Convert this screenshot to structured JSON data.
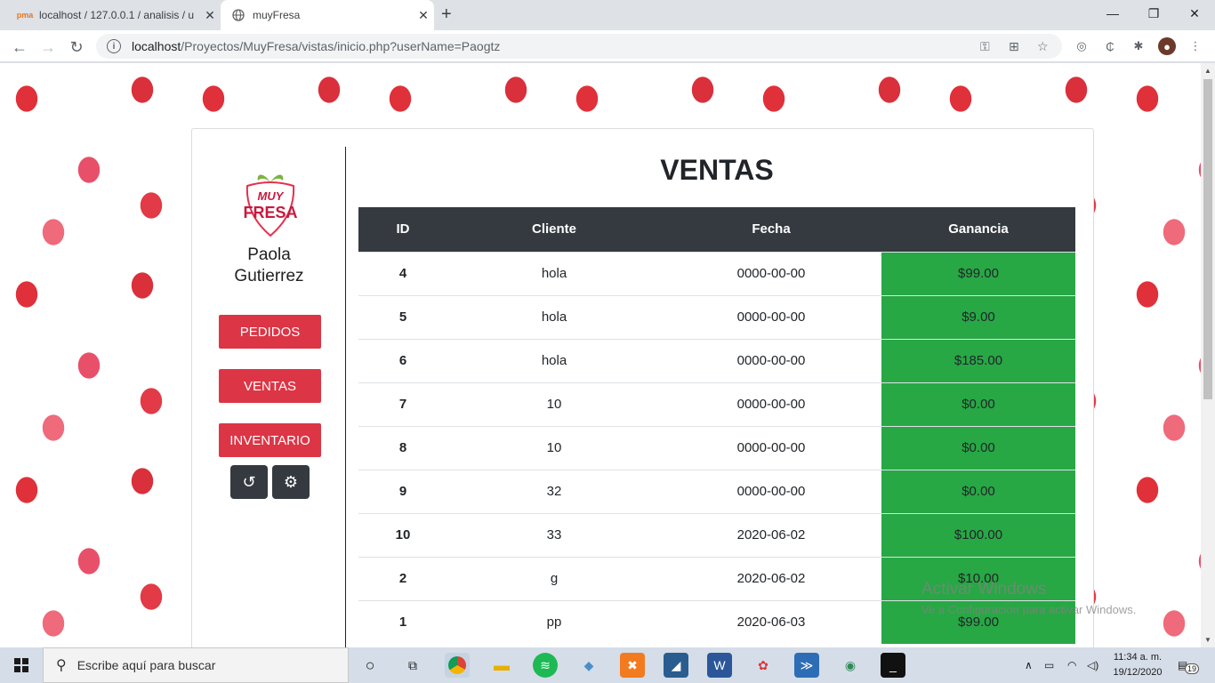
{
  "browser": {
    "tabs": [
      {
        "title": "localhost / 127.0.0.1 / analisis / u",
        "favicon": "phpmyadmin-icon"
      },
      {
        "title": "muyFresa",
        "favicon": "globe-icon"
      }
    ],
    "url_host": "localhost",
    "url_path": "/Proyectos/MuyFresa/vistas/inicio.php?userName=Paogtz"
  },
  "sidebar": {
    "logo_line1": "MUY",
    "logo_line2": "FRESA",
    "user_name": "Paola Gutierrez",
    "buttons": [
      "PEDIDOS",
      "VENTAS",
      "INVENTARIO"
    ],
    "icon_buttons": [
      "undo-icon",
      "gear-icon"
    ]
  },
  "main": {
    "title": "VENTAS",
    "columns": [
      "ID",
      "Cliente",
      "Fecha",
      "Ganancia"
    ],
    "rows": [
      {
        "id": "4",
        "cliente": "hola",
        "fecha": "0000-00-00",
        "ganancia": "$99.00"
      },
      {
        "id": "5",
        "cliente": "hola",
        "fecha": "0000-00-00",
        "ganancia": "$9.00"
      },
      {
        "id": "6",
        "cliente": "hola",
        "fecha": "0000-00-00",
        "ganancia": "$185.00"
      },
      {
        "id": "7",
        "cliente": "10",
        "fecha": "0000-00-00",
        "ganancia": "$0.00"
      },
      {
        "id": "8",
        "cliente": "10",
        "fecha": "0000-00-00",
        "ganancia": "$0.00"
      },
      {
        "id": "9",
        "cliente": "32",
        "fecha": "0000-00-00",
        "ganancia": "$0.00"
      },
      {
        "id": "10",
        "cliente": "33",
        "fecha": "2020-06-02",
        "ganancia": "$100.00"
      },
      {
        "id": "2",
        "cliente": "g",
        "fecha": "2020-06-02",
        "ganancia": "$10.00"
      },
      {
        "id": "1",
        "cliente": "pp",
        "fecha": "2020-06-03",
        "ganancia": "$99.00"
      }
    ]
  },
  "watermark": {
    "line1": "Activar Windows",
    "line2": "Ve a Configuración para activar Windows."
  },
  "taskbar": {
    "search_placeholder": "Escribe aquí para buscar",
    "time": "11:34 a. m.",
    "date": "19/12/2020",
    "notification_count": "19"
  },
  "colors": {
    "accent_red": "#dc3545",
    "dark": "#343a40",
    "green": "#28a745"
  }
}
